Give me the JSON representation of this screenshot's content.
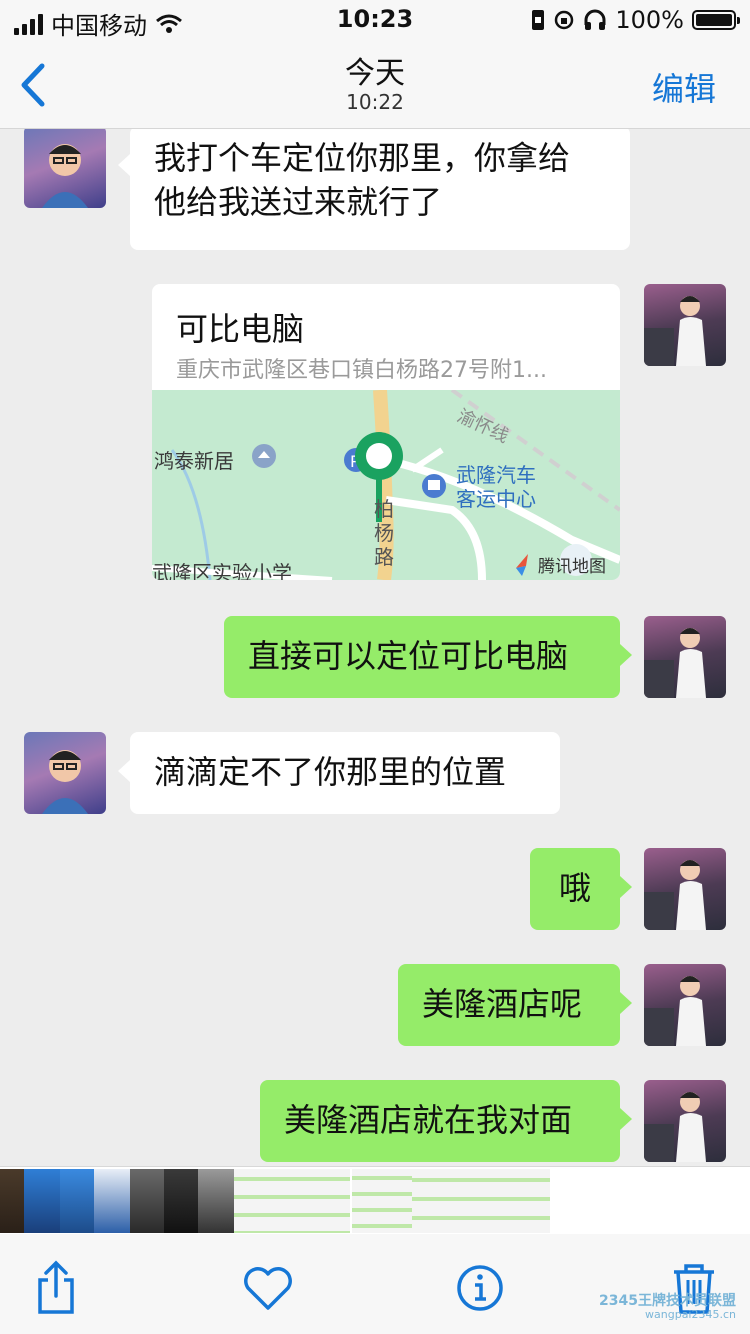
{
  "status_bar": {
    "carrier": "中国移动",
    "time": "10:23",
    "battery": "100%"
  },
  "nav": {
    "title": "今天",
    "subtitle": "10:22",
    "edit_label": "编辑"
  },
  "messages": [
    {
      "side": "left",
      "text_line1": "我打个车定位你那里，你拿给",
      "text_line2": "他给我送过来就行了"
    },
    {
      "side": "right",
      "type": "location",
      "title": "可比电脑",
      "address": "重庆市武隆区巷口镇白杨路27号附1..."
    },
    {
      "side": "right",
      "text": "直接可以定位可比电脑"
    },
    {
      "side": "left",
      "text": "滴滴定不了你那里的位置"
    },
    {
      "side": "right",
      "text": "哦"
    },
    {
      "side": "right",
      "text": "美隆酒店呢"
    },
    {
      "side": "right",
      "text": "美隆酒店就在我对面"
    }
  ],
  "map": {
    "labels": {
      "road_top": "渝怀线",
      "poi_left": "鸿泰新居",
      "station": "武隆汽车",
      "station2": "客运中心",
      "road_vertical_1": "柏",
      "road_vertical_2": "杨",
      "road_vertical_3": "路",
      "school": "武隆区实验小学",
      "brand": "腾讯地图"
    },
    "colors": {
      "land": "#bfe6c6",
      "road": "#ffffff",
      "main_road": "#f2d38f",
      "pin": "#1aa260"
    }
  },
  "toolbar": {
    "icons": [
      "share-icon",
      "heart-icon",
      "info-icon",
      "trash-icon"
    ]
  },
  "watermark": {
    "line1": "2345王牌技术员联盟",
    "line2": "wangpai2345.cn"
  }
}
